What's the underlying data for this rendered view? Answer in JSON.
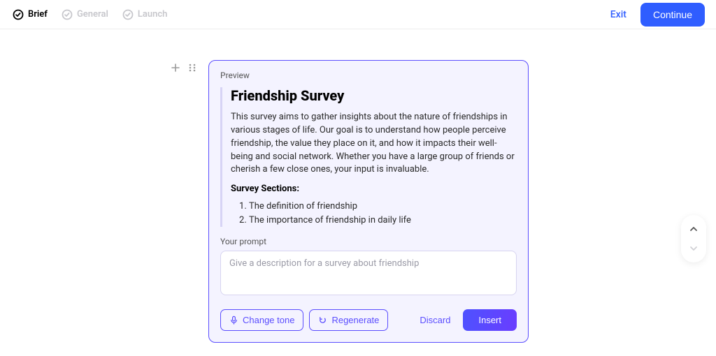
{
  "header": {
    "steps": [
      {
        "label": "Brief",
        "active": true
      },
      {
        "label": "General",
        "active": false
      },
      {
        "label": "Launch",
        "active": false
      }
    ],
    "exit_label": "Exit",
    "continue_label": "Continue"
  },
  "card": {
    "preview_label": "Preview",
    "title": "Friendship Survey",
    "description": "This survey aims to gather insights about the nature of friendships in various stages of life. Our goal is to understand how people perceive friendship, the value they place on it, and how it impacts their well-being and social network. Whether you have a large group of friends or cherish a few close ones, your input is invaluable.",
    "sections_heading": "Survey Sections:",
    "sections": [
      "The definition of friendship",
      "The importance of friendship in daily life"
    ],
    "prompt_label": "Your prompt",
    "prompt_placeholder": "Give a description for a survey about friendship",
    "prompt_value": "",
    "actions": {
      "change_tone": "Change tone",
      "regenerate": "Regenerate",
      "discard": "Discard",
      "insert": "Insert"
    }
  },
  "icons": {
    "check": "check-circle-icon",
    "plus": "plus-icon",
    "grip": "drag-handle-icon",
    "mic": "microphone-icon",
    "refresh": "refresh-icon",
    "chevron_up": "chevron-up-icon",
    "chevron_down": "chevron-down-icon"
  },
  "colors": {
    "primary_blue": "#2f5dff",
    "accent_purple": "#5a4dff",
    "card_bg": "#f4f3ff"
  }
}
